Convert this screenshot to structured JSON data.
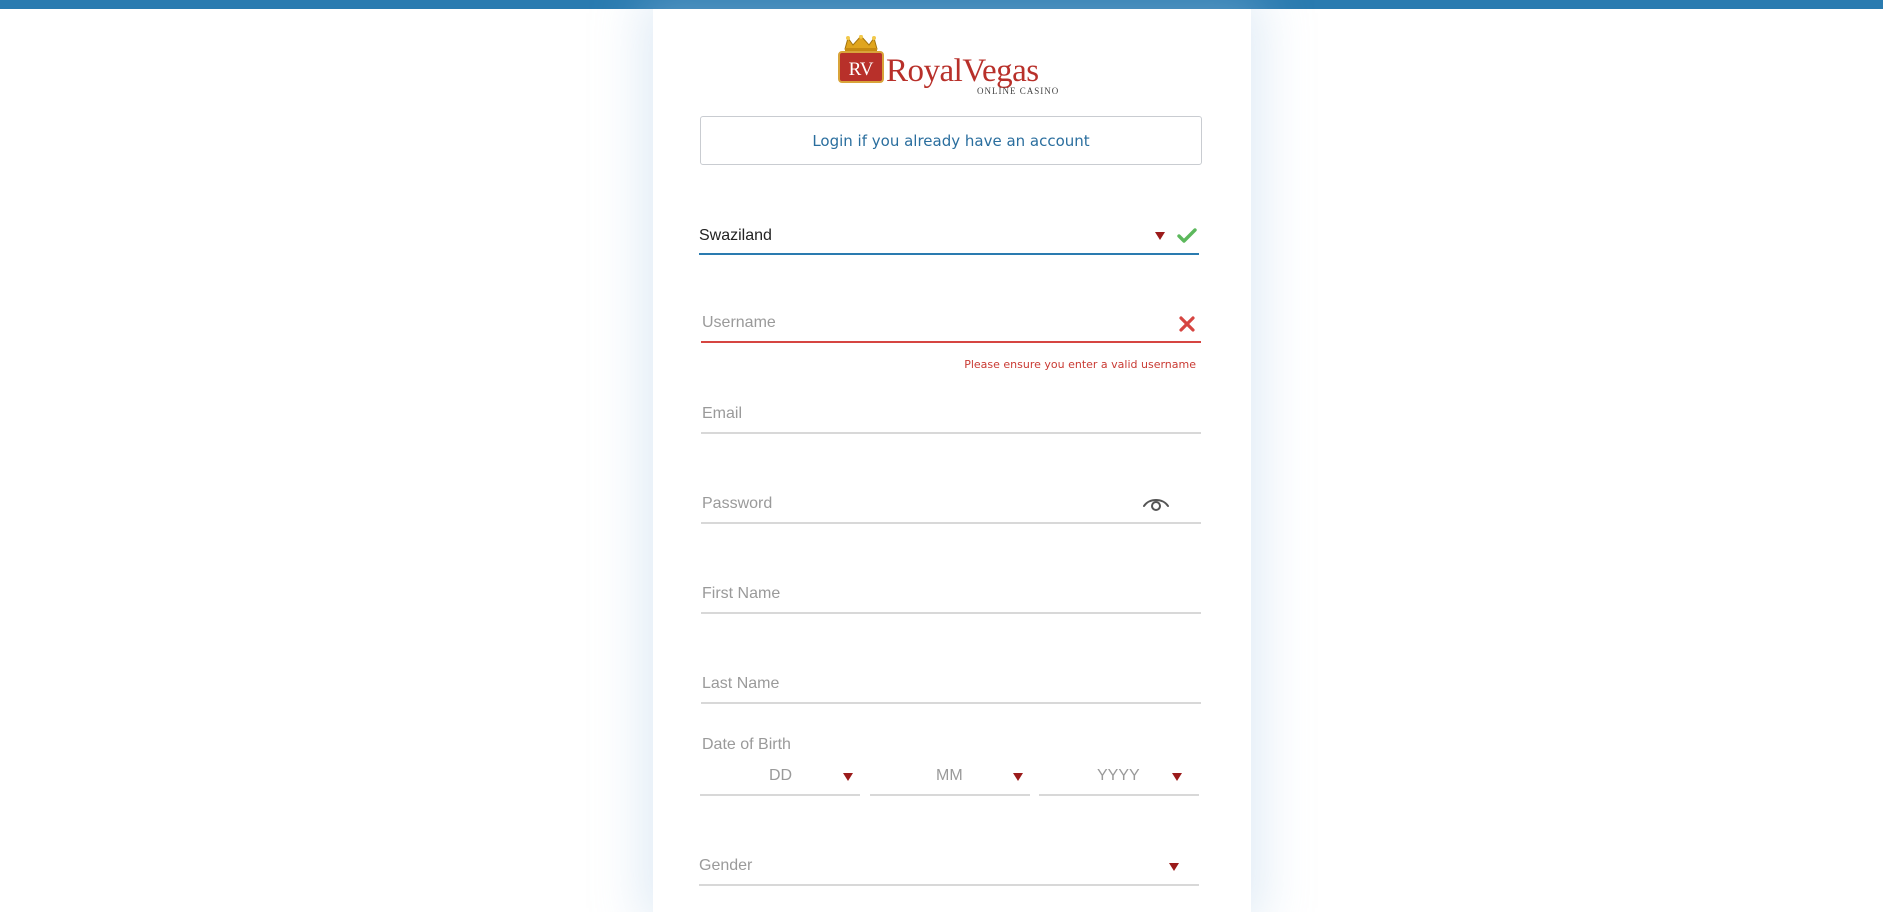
{
  "brand": {
    "logo_monogram": "RV",
    "logo_name": "RoyalVegas",
    "logo_tagline": "ONLINE CASINO",
    "primary_color": "#2a7bb0",
    "brand_red": "#b8302a",
    "error_color": "#d64541",
    "success_color": "#5cb85c"
  },
  "login_link": "Login if you already have an account",
  "form": {
    "country": {
      "value": "Swaziland"
    },
    "username": {
      "placeholder": "Username",
      "error": "Please ensure you enter a valid username"
    },
    "email": {
      "placeholder": "Email"
    },
    "password": {
      "placeholder": "Password"
    },
    "first_name": {
      "placeholder": "First Name"
    },
    "last_name": {
      "placeholder": "Last Name"
    },
    "dob": {
      "label": "Date of Birth",
      "day": "DD",
      "month": "MM",
      "year": "YYYY"
    },
    "gender": {
      "placeholder": "Gender"
    }
  }
}
